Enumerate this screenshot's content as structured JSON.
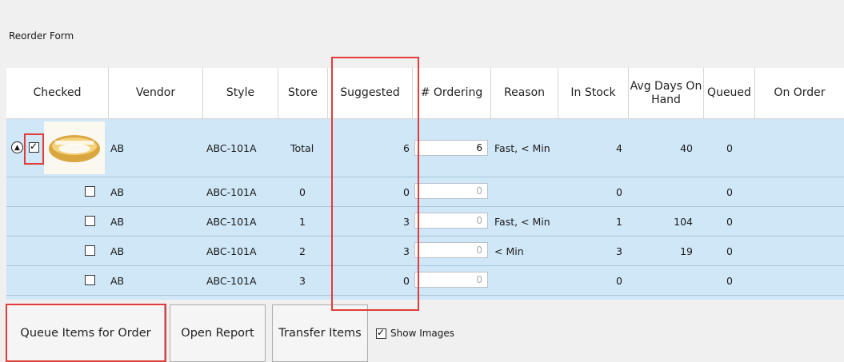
{
  "form": {
    "title": "Reorder Form"
  },
  "columns": [
    "Checked",
    "Vendor",
    "Style",
    "Store",
    "Suggested",
    "# Ordering",
    "Reason",
    "In Stock",
    "Avg Days On Hand",
    "Queued",
    "On Order"
  ],
  "rows": [
    {
      "checked": true,
      "vendor": "AB",
      "style": "ABC-101A",
      "store": "Total",
      "suggested": "6",
      "ordering": "6",
      "reason": "Fast, < Min",
      "in_stock": "4",
      "avg_days": "40",
      "queued": "0"
    },
    {
      "checked": false,
      "vendor": "AB",
      "style": "ABC-101A",
      "store": "0",
      "suggested": "0",
      "ordering": "0",
      "reason": "",
      "in_stock": "0",
      "avg_days": "",
      "queued": "0"
    },
    {
      "checked": false,
      "vendor": "AB",
      "style": "ABC-101A",
      "store": "1",
      "suggested": "3",
      "ordering": "0",
      "reason": "Fast, < Min",
      "in_stock": "1",
      "avg_days": "104",
      "queued": "0"
    },
    {
      "checked": false,
      "vendor": "AB",
      "style": "ABC-101A",
      "store": "2",
      "suggested": "3",
      "ordering": "0",
      "reason": "< Min",
      "in_stock": "3",
      "avg_days": "19",
      "queued": "0"
    },
    {
      "checked": false,
      "vendor": "AB",
      "style": "ABC-101A",
      "store": "3",
      "suggested": "0",
      "ordering": "0",
      "reason": "",
      "in_stock": "0",
      "avg_days": "",
      "queued": "0"
    }
  ],
  "buttons": {
    "queue": "Queue Items for Order",
    "open_report": "Open Report",
    "transfer": "Transfer Items"
  },
  "show_images": {
    "label": "Show Images",
    "checked": true
  },
  "colors": {
    "row_bg": "#cfe7f7",
    "highlight": "#e23b3b"
  }
}
